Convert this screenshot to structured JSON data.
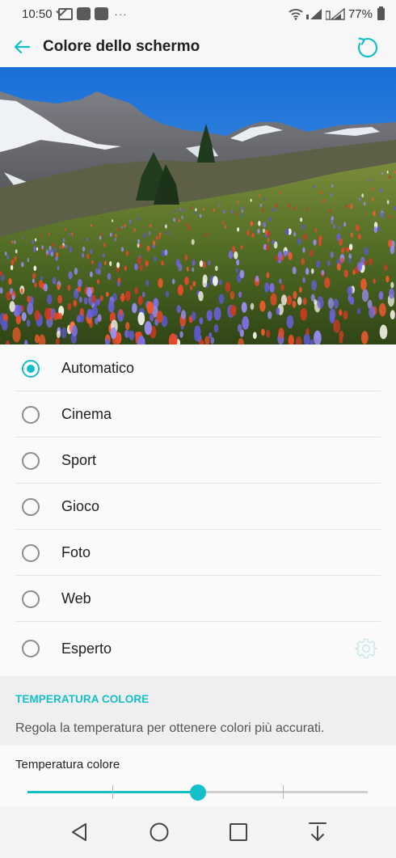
{
  "status_bar": {
    "time": "10:50",
    "notification_icons": [
      "mail-icon",
      "app-icon",
      "app-icon"
    ],
    "more_indicator": "···",
    "battery": "77%",
    "icons": [
      "wifi-icon",
      "signal-icon",
      "signal-icon",
      "battery-icon"
    ]
  },
  "header": {
    "back_icon": "arrow-left-icon",
    "title": "Colore dello schermo",
    "reset_icon": "reset-icon",
    "accent_color": "#14bfc9"
  },
  "preview_image": {
    "subject": "mountain meadow with wildflowers"
  },
  "modes": {
    "selected": "Automatico",
    "items": [
      {
        "label": "Automatico",
        "checked": true
      },
      {
        "label": "Cinema",
        "checked": false
      },
      {
        "label": "Sport",
        "checked": false
      },
      {
        "label": "Gioco",
        "checked": false
      },
      {
        "label": "Foto",
        "checked": false
      },
      {
        "label": "Web",
        "checked": false
      },
      {
        "label": "Esperto",
        "checked": false,
        "settings_icon": "gear-icon"
      }
    ]
  },
  "temperature": {
    "section_title": "TEMPERATURA COLORE",
    "description": "Regola la temperatura per ottenere colori più accurati.",
    "slider_label": "Temperatura colore",
    "slider_value": 0.5
  },
  "nav_bar": {
    "icons": [
      "back-triangle-icon",
      "home-circle-icon",
      "recents-square-icon",
      "notification-pull-icon"
    ]
  }
}
